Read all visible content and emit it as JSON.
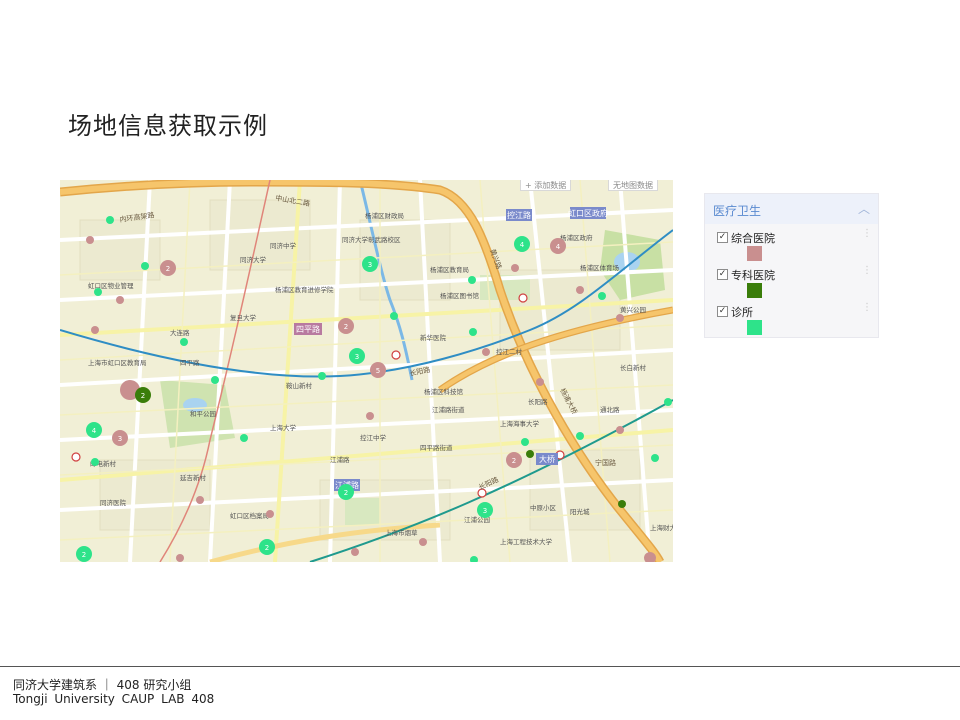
{
  "slide": {
    "title": "场地信息获取示例"
  },
  "map": {
    "top_tags": {
      "add_data": "+ 添加数据",
      "no_data": "无地图数据"
    },
    "road_labels": [
      {
        "text": "内环高架路",
        "color": "#7a5a20"
      },
      {
        "text": "中山北二路",
        "color": "#7a5a20"
      },
      {
        "text": "四平路",
        "color": "#4a4a4a"
      },
      {
        "text": "黄兴路",
        "color": "#4a4a4a"
      },
      {
        "text": "江浦路",
        "color": "#4a4a4a"
      },
      {
        "text": "杨浦大桥",
        "color": "#4a4a4a"
      },
      {
        "text": "宁国路",
        "color": "#4a4a4a"
      },
      {
        "text": "控江路",
        "color": "#4a4a4a"
      },
      {
        "text": "大桥",
        "color": "#4a4a4a"
      },
      {
        "text": "长阳路",
        "color": "#4a4a4a"
      },
      {
        "text": "长阳路",
        "color": "#4a4a4a"
      }
    ],
    "place_labels": [
      "同济大学",
      "同济大学彰武路校区",
      "杨浦区教育局",
      "杨浦区财政局",
      "上海市虹口区教育局",
      "四平路",
      "和平公园",
      "虹口区物业管理",
      "邮电新村",
      "虹口区档案局",
      "鞍山新村",
      "江浦路街道",
      "杨浦区教育进修学院",
      "杨浦区科技馆",
      "上海市烟草",
      "江浦公园",
      "复旦大学",
      "控江二村",
      "杨浦区政府",
      "黄兴公园",
      "长阳路",
      "大连路",
      "杨浦区图书馆",
      "虹口区政府",
      "延吉新村",
      "上海海事大学",
      "上海大学",
      "江浦路",
      "四平路街道",
      "阳光城",
      "杨浦区体育场",
      "长白新村",
      "通北路",
      "上海工程技术大学",
      "新华医院",
      "控江中学",
      "同济医院",
      "同济中学",
      "中原小区",
      "上海财大"
    ],
    "cluster_counts": [
      "2",
      "3",
      "2",
      "4",
      "4",
      "3",
      "2",
      "2",
      "2",
      "3",
      "5",
      "2",
      "2",
      "3",
      "4"
    ]
  },
  "legend": {
    "title": "医疗卫生",
    "collapse_icon": "chevron-up-icon",
    "items": [
      {
        "label": "综合医院",
        "color": "#c98f8f",
        "checked": "✓"
      },
      {
        "label": "专科医院",
        "color": "#3a7d0a",
        "checked": "✓"
      },
      {
        "label": "诊所",
        "color": "#2ee38a",
        "checked": "✓"
      }
    ]
  },
  "footer": {
    "line1": "同济大学建筑系 ｜ 408 研究小组",
    "line2": "Tongji University CAUP  LAB 408"
  }
}
